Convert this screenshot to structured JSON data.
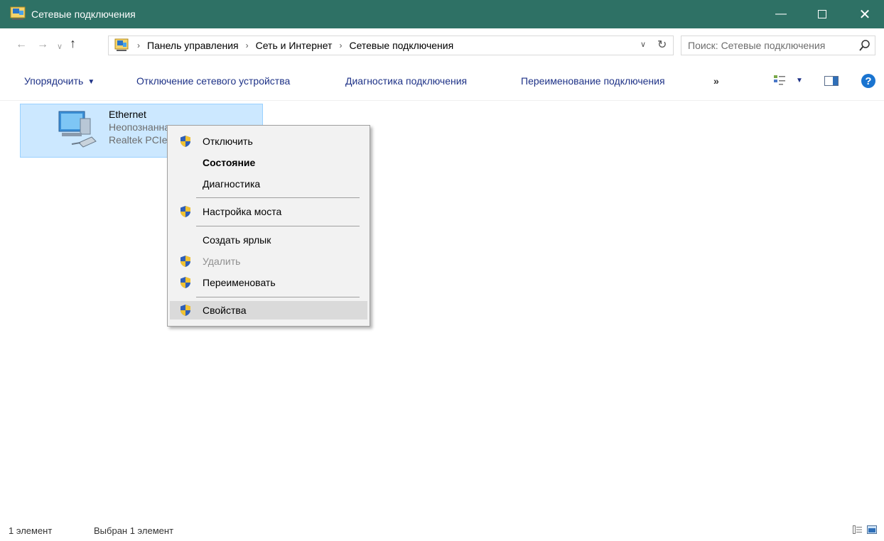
{
  "window": {
    "title": "Сетевые подключения",
    "minimize_icon": "minimize-icon",
    "maximize_icon": "maximize-icon",
    "close_icon": "close-icon"
  },
  "address_bar": {
    "breadcrumbs": [
      "Панель управления",
      "Сеть и Интернет",
      "Сетевые подключения"
    ],
    "search_placeholder": "Поиск: Сетевые подключения"
  },
  "command_bar": {
    "organize": "Упорядочить",
    "disable_device": "Отключение сетевого устройства",
    "diagnose": "Диагностика подключения",
    "rename": "Переименование подключения",
    "more": "»"
  },
  "connection": {
    "name": "Ethernet",
    "status": "Неопознанная сеть",
    "adapter": "Realtek PCIe GBE Family Controller"
  },
  "context_menu": {
    "items": [
      {
        "label": "Отключить",
        "shield": true
      },
      {
        "label": "Состояние",
        "bold": true
      },
      {
        "label": "Диагностика"
      },
      {
        "label": "Настройка моста",
        "shield": true
      },
      {
        "label": "Создать ярлык"
      },
      {
        "label": "Удалить",
        "shield": true,
        "disabled": true
      },
      {
        "label": "Переименовать",
        "shield": true
      },
      {
        "label": "Свойства",
        "shield": true,
        "highlighted": true
      }
    ]
  },
  "status_bar": {
    "count": "1 элемент",
    "selected": "Выбран 1 элемент"
  },
  "colors": {
    "titlebar": "#2e7165",
    "selection": "#cce8ff",
    "link_text": "#1e3287"
  }
}
